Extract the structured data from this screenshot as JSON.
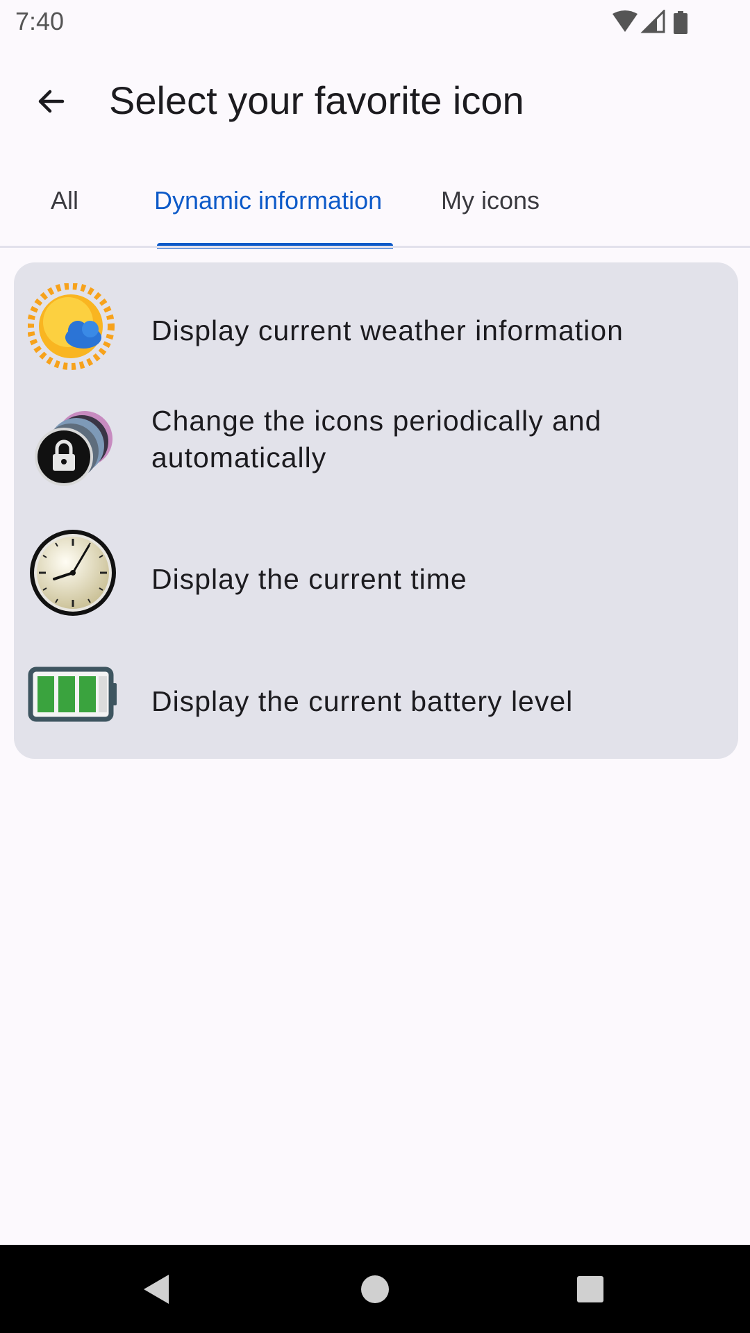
{
  "status_bar": {
    "time": "7:40"
  },
  "app_bar": {
    "title": "Select your favorite icon"
  },
  "tabs": [
    {
      "label": "All",
      "active": false
    },
    {
      "label": "Dynamic information",
      "active": true
    },
    {
      "label": "My icons",
      "active": false
    }
  ],
  "colors": {
    "accent": "#0d5ac8",
    "background": "#fcf9fd",
    "card": "#e2e2ea"
  },
  "options": [
    {
      "label": "Display current weather information",
      "icon": "weather-icon"
    },
    {
      "label": "Change the icons periodically and automatically",
      "icon": "rotating-icons-icon"
    },
    {
      "label": "Display the current time",
      "icon": "clock-icon"
    },
    {
      "label": "Display the current battery level",
      "icon": "battery-level-icon"
    }
  ],
  "nav_bar": {
    "buttons": [
      "back",
      "home",
      "recents"
    ]
  }
}
